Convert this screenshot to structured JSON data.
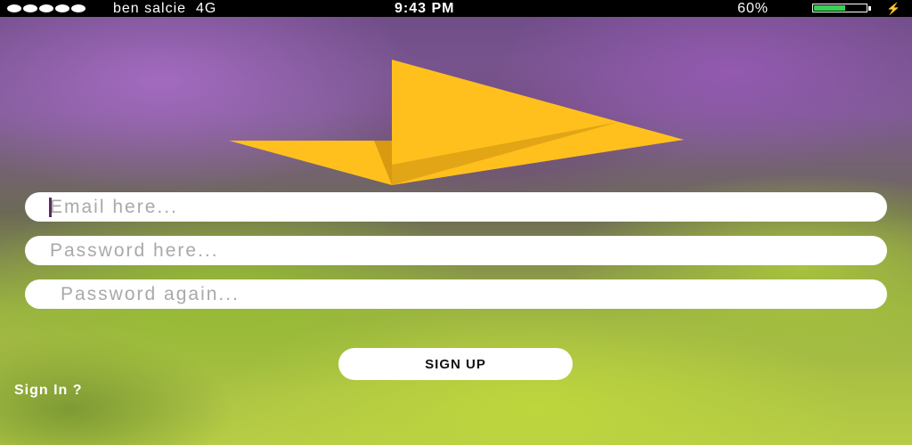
{
  "status_bar": {
    "carrier": "ben salcie",
    "network": "4G",
    "time": "9:43 PM",
    "battery_percent": "60%",
    "battery_level": 0.6,
    "signal_dots": 5
  },
  "form": {
    "email_placeholder": "Email here...",
    "password_placeholder": "Password here...",
    "password_again_placeholder": "Password again..."
  },
  "actions": {
    "signup_label": "SIGN UP",
    "signin_label": "Sign In ?"
  },
  "colors": {
    "logo_primary": "#FFC01E",
    "logo_shade": "#D99A12",
    "caret": "#5B2A63",
    "battery_fill": "#39D153"
  },
  "icons": {
    "logo": "paper-plane-logo",
    "charging": "lightning-bolt-icon",
    "battery": "battery-icon",
    "signal": "signal-dots-icon"
  }
}
